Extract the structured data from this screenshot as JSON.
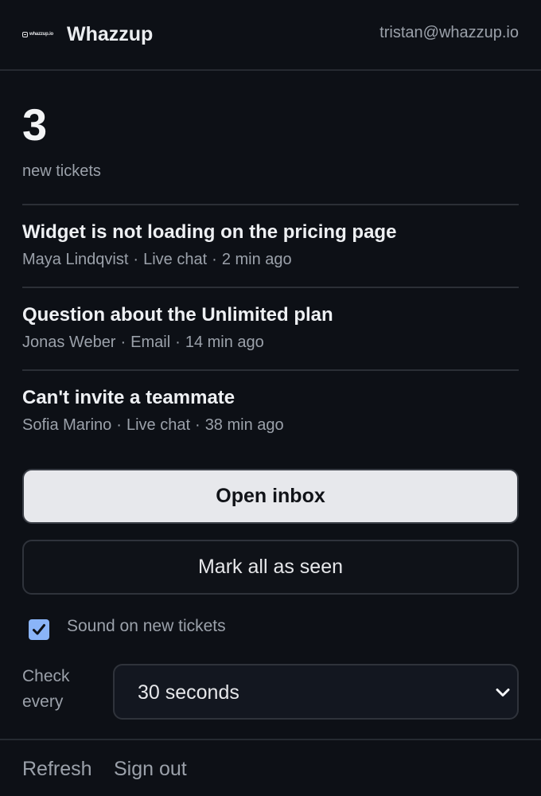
{
  "header": {
    "logo_text": "whazzup.io",
    "brand": "Whazzup",
    "account_email": "tristan@whazzup.io"
  },
  "summary": {
    "count": "3",
    "label": "new tickets"
  },
  "tickets": [
    {
      "title": "Widget is not loading on the pricing page",
      "customer": "Maya Lindqvist",
      "channel": "Live chat",
      "age": "2 min ago"
    },
    {
      "title": "Question about the Unlimited plan",
      "customer": "Jonas Weber",
      "channel": "Email",
      "age": "14 min ago"
    },
    {
      "title": "Can't invite a teammate",
      "customer": "Sofia Marino",
      "channel": "Live chat",
      "age": "38 min ago"
    }
  ],
  "meta_separator": "·",
  "actions": {
    "open_inbox": "Open inbox",
    "mark_seen": "Mark all as seen"
  },
  "settings": {
    "sound_label": "Sound on new tickets",
    "sound_checked": true,
    "interval_label": "Check every",
    "interval_value": "30 seconds"
  },
  "footer": {
    "refresh": "Refresh",
    "sign_out": "Sign out"
  },
  "colors": {
    "background": "#0d1016",
    "checkbox_accent": "#8ab4f8",
    "primary_button": "#e7e8ec",
    "muted_text": "#9ba1aa"
  }
}
